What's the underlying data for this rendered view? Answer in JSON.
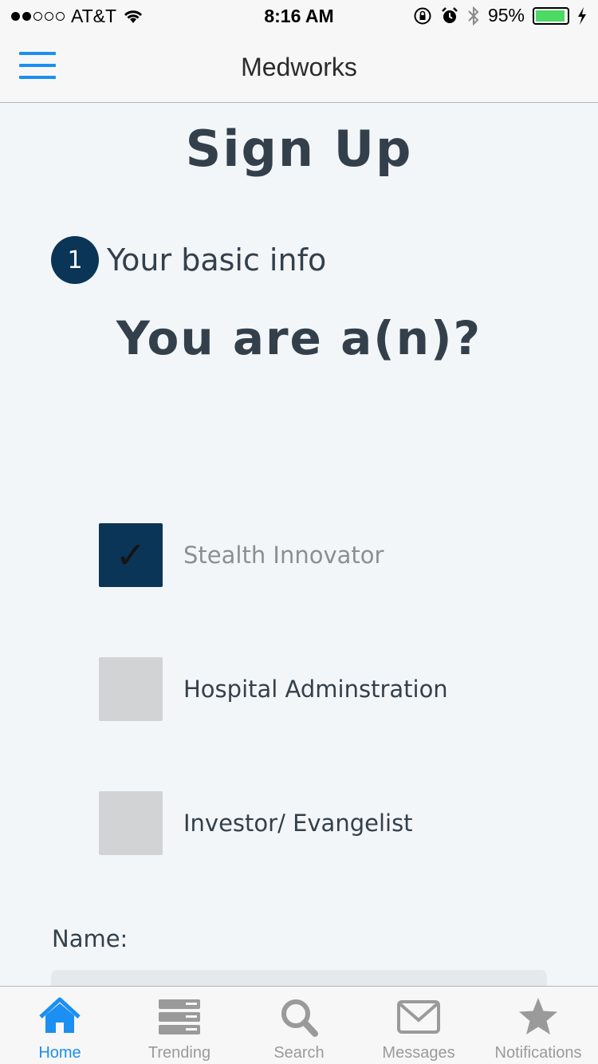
{
  "status_bar": {
    "carrier": "AT&T",
    "time": "8:16 AM",
    "battery_percent": "95%",
    "battery_level": 0.95,
    "signal_bars": 2,
    "signal_total": 5
  },
  "nav": {
    "title": "Medworks",
    "menu_icon": "hamburger-menu-icon",
    "accent_color": "#1b8ff2"
  },
  "page": {
    "title": "Sign Up",
    "step_number": "1",
    "step_label": "Your basic info",
    "question": "You are a(n)?"
  },
  "options": [
    {
      "label": "Stealth Innovator",
      "checked": true
    },
    {
      "label": "Hospital Adminstration",
      "checked": false
    },
    {
      "label": "Investor/ Evangelist",
      "checked": false
    }
  ],
  "form": {
    "name_label": "Name:",
    "name_value": ""
  },
  "tabs": [
    {
      "label": "Home",
      "icon": "home-icon",
      "active": true
    },
    {
      "label": "Trending",
      "icon": "trending-icon",
      "active": false
    },
    {
      "label": "Search",
      "icon": "search-icon",
      "active": false
    },
    {
      "label": "Messages",
      "icon": "messages-icon",
      "active": false
    },
    {
      "label": "Notifications",
      "icon": "star-icon",
      "active": false
    }
  ],
  "colors": {
    "primary_dark": "#0b3556",
    "accent": "#1b8ff2",
    "inactive": "#9a9a9a",
    "checkbox_off": "#d2d3d5"
  }
}
